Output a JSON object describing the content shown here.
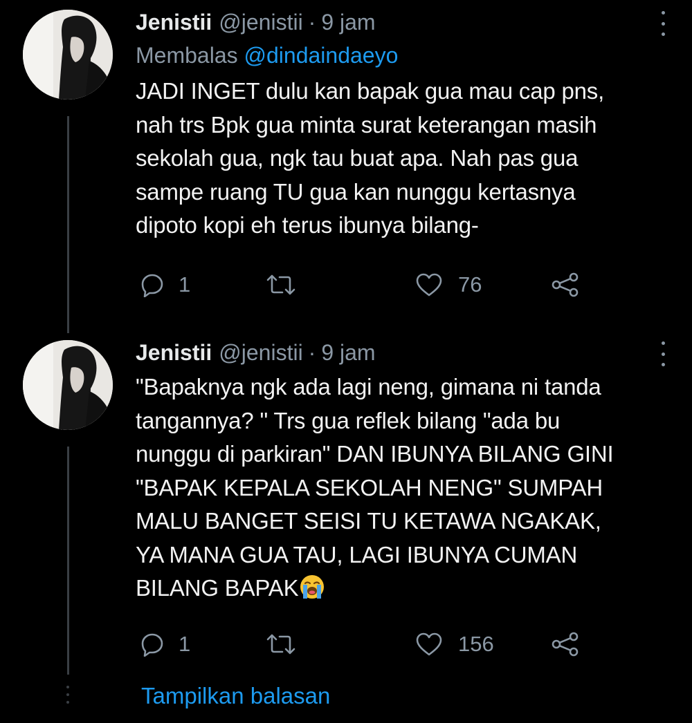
{
  "tweets": [
    {
      "display_name": "Jenistii",
      "handle": "@jenistii",
      "separator": "·",
      "time": "9 jam",
      "reply_prefix": "Membalas",
      "reply_mention": "@dindaindaeyo",
      "text": "JADI INGET dulu kan bapak gua mau cap pns,\nnah trs Bpk gua minta surat keterangan masih\nsekolah gua, ngk tau buat apa. Nah pas gua\nsampe ruang TU gua kan nunggu kertasnya\ndipoto kopi eh terus ibunya bilang-",
      "replies": "1",
      "retweets": "",
      "likes": "76"
    },
    {
      "display_name": "Jenistii",
      "handle": "@jenistii",
      "separator": "·",
      "time": "9 jam",
      "text": "\"Bapaknya ngk ada lagi neng, gimana ni tanda\ntangannya? \" Trs gua reflek bilang \"ada bu\nnunggu di parkiran\" DAN IBUNYA BILANG GINI\n\"BAPAK KEPALA SEKOLAH NENG\" SUMPAH\nMALU BANGET SEISI TU KETAWA NGAKAK,\nYA MANA GUA TAU, LAGI IBUNYA CUMAN\nBILANG BAPAK",
      "emoji": "loudly-crying-face",
      "replies": "1",
      "retweets": "",
      "likes": "156"
    }
  ],
  "show_replies_label": "Tampilkan balasan",
  "colors": {
    "background": "#000000",
    "text": "#e7e9ea",
    "secondary": "#8b98a5",
    "accent": "#1d9bf0",
    "thread_line": "#3a3f44"
  },
  "icons": [
    "reply-icon",
    "retweet-icon",
    "like-icon",
    "share-icon",
    "more-options-icon"
  ]
}
